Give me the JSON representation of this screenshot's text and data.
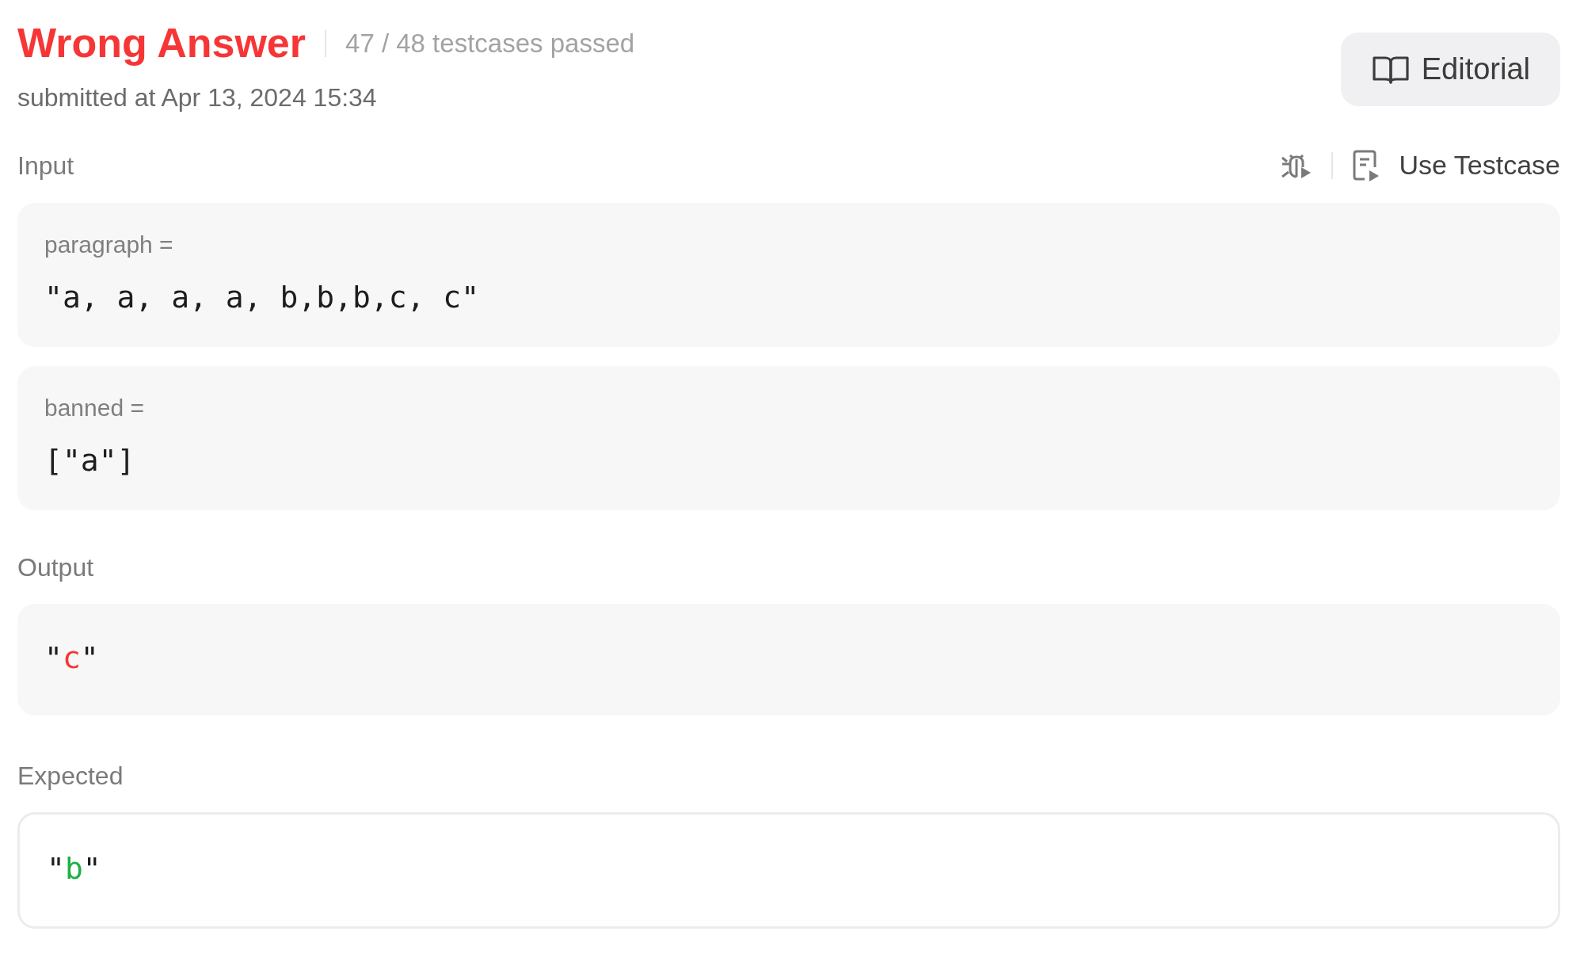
{
  "result": {
    "status": "Wrong Answer",
    "testcases": "47 / 48 testcases passed",
    "submitted": "submitted at Apr 13, 2024 15:34"
  },
  "editorial_button": {
    "label": "Editorial"
  },
  "input": {
    "label": "Input",
    "use_testcase": "Use Testcase",
    "params": [
      {
        "name": "paragraph =",
        "value": "\"a, a, a, a, b,b,b,c, c\""
      },
      {
        "name": "banned =",
        "value": "[\"a\"]"
      }
    ]
  },
  "results": [
    {
      "label": "Output",
      "kind": "filled",
      "parts": [
        {
          "text": "\""
        },
        {
          "text": "c",
          "color": "#f63636"
        },
        {
          "text": "\""
        }
      ]
    },
    {
      "label": "Expected",
      "kind": "bordered",
      "parts": [
        {
          "text": "\""
        },
        {
          "text": "b",
          "color": "#1fb046"
        },
        {
          "text": "\""
        }
      ]
    }
  ]
}
